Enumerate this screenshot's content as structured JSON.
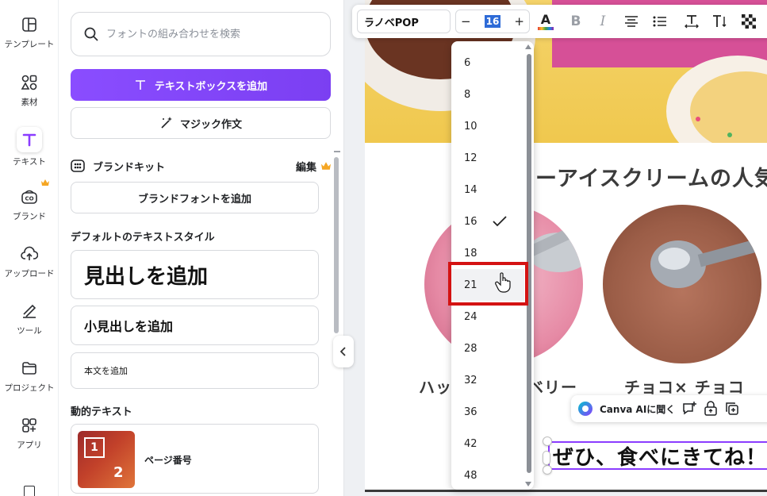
{
  "rail": {
    "items": [
      {
        "label": "テンプレート",
        "icon": "template-icon"
      },
      {
        "label": "素材",
        "icon": "elements-icon"
      },
      {
        "label": "テキスト",
        "icon": "text-icon"
      },
      {
        "label": "ブランド",
        "icon": "brand-icon"
      },
      {
        "label": "アップロード",
        "icon": "upload-icon"
      },
      {
        "label": "ツール",
        "icon": "tools-icon"
      },
      {
        "label": "プロジェクト",
        "icon": "folder-icon"
      },
      {
        "label": "アプリ",
        "icon": "apps-icon"
      }
    ]
  },
  "panel": {
    "search_placeholder": "フォントの組み合わせを検索",
    "add_textbox": "テキストボックスを追加",
    "magic_write": "マジック作文",
    "brand_kit": "ブランドキット",
    "brand_edit": "編集",
    "brand_add_font": "ブランドフォントを追加",
    "default_styles_title": "デフォルトのテキストスタイル",
    "heading": "見出しを追加",
    "subheading": "小見出しを追加",
    "body": "本文を追加",
    "dynamic_title": "動的テキスト",
    "page_number": "ページ番号",
    "thumb_digit_1": "1",
    "thumb_digit_2": "2"
  },
  "toolbar": {
    "font": "ラノベPOP",
    "minus": "−",
    "size": "16",
    "plus": "+",
    "bold": "B",
    "italic": "I",
    "text_color_letter": "A"
  },
  "dropdown": {
    "sizes": [
      "6",
      "8",
      "10",
      "12",
      "14",
      "16",
      "18",
      "21",
      "24",
      "28",
      "32",
      "36",
      "42",
      "48"
    ],
    "selected": "16",
    "hovered": "21"
  },
  "canvas": {
    "heading": "ーアイスクリームの人気",
    "caption_left_a": "ハッ",
    "caption_left_b": "ベリー",
    "caption_right": "チョコ× チョコ",
    "selected_text": "ぜひ、食べにきてね！",
    "ai_label": "Canva AIに聞く"
  },
  "colors": {
    "accent": "#8b3dff",
    "highlight": "#d41212",
    "size_selection": "#2e6bd7"
  }
}
